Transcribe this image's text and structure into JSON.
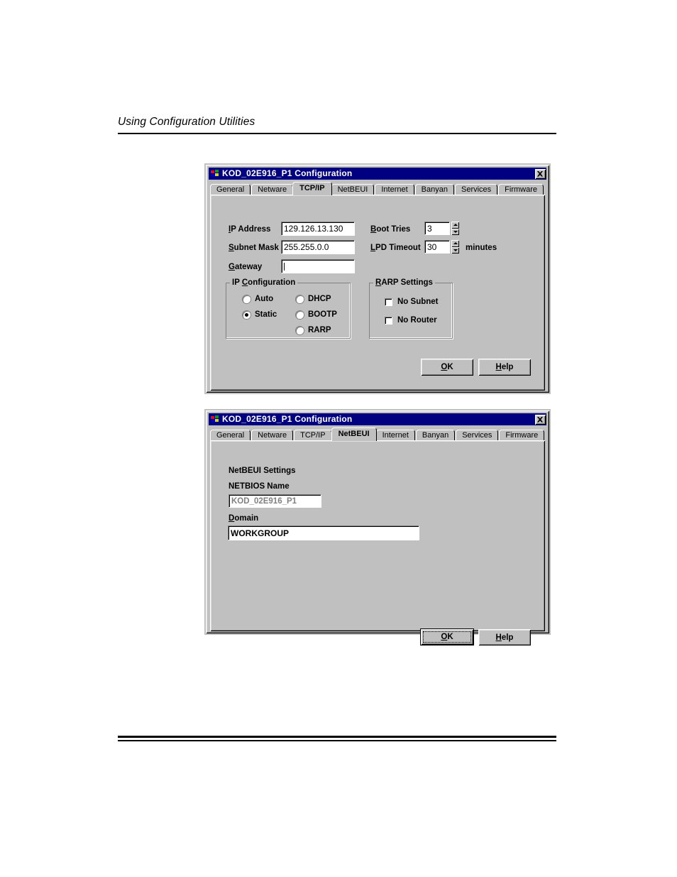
{
  "document": {
    "running_head": "Using Configuration Utilities"
  },
  "dialogs": [
    {
      "title": "KOD_02E916_P1 Configuration",
      "close_label": "Close",
      "tabs": [
        {
          "label": "General",
          "selected": false
        },
        {
          "label": "Netware",
          "selected": false
        },
        {
          "label": "TCP/IP",
          "selected": true
        },
        {
          "label": "NetBEUI",
          "selected": false
        },
        {
          "label": "Internet",
          "selected": false
        },
        {
          "label": "Banyan",
          "selected": false
        },
        {
          "label": "Services",
          "selected": false
        },
        {
          "label": "Firmware",
          "selected": false
        }
      ],
      "fields": {
        "ip_address_label": "IP Address",
        "ip_address_accel": "I",
        "ip_address_value": "129.126.13.130",
        "subnet_mask_label": "Subnet Mask",
        "subnet_mask_accel": "S",
        "subnet_mask_value": "255.255.0.0",
        "gateway_label": "Gateway",
        "gateway_accel": "G",
        "gateway_value": "",
        "boot_tries_label": "Boot Tries",
        "boot_tries_accel": "B",
        "boot_tries_value": "3",
        "lpd_timeout_label": "LPD Timeout",
        "lpd_timeout_accel": "L",
        "lpd_timeout_value": "30",
        "lpd_timeout_units": "minutes"
      },
      "ip_configuration": {
        "title": "IP Configuration",
        "accel": "C",
        "options": [
          {
            "label": "Auto",
            "selected": false
          },
          {
            "label": "Static",
            "selected": true
          },
          {
            "label": "DHCP",
            "selected": false
          },
          {
            "label": "BOOTP",
            "selected": false
          },
          {
            "label": "RARP",
            "selected": false
          }
        ]
      },
      "rarp_settings": {
        "title": "RARP Settings",
        "accel": "R",
        "options": [
          {
            "label": "No Subnet",
            "checked": false
          },
          {
            "label": "No Router",
            "checked": false
          }
        ]
      },
      "buttons": [
        {
          "label": "OK",
          "accel": "O",
          "default": false,
          "focused": false
        },
        {
          "label": "Help",
          "accel": "H",
          "default": false,
          "focused": false
        }
      ]
    },
    {
      "title": "KOD_02E916_P1 Configuration",
      "close_label": "Close",
      "tabs": [
        {
          "label": "General",
          "selected": false
        },
        {
          "label": "Netware",
          "selected": false
        },
        {
          "label": "TCP/IP",
          "selected": false
        },
        {
          "label": "NetBEUI",
          "selected": true
        },
        {
          "label": "Internet",
          "selected": false
        },
        {
          "label": "Banyan",
          "selected": false
        },
        {
          "label": "Services",
          "selected": false
        },
        {
          "label": "Firmware",
          "selected": false
        }
      ],
      "netbeui": {
        "section_title": "NetBEUI Settings",
        "netbios_label": "NETBIOS Name",
        "netbios_value": "KOD_02E916_P1",
        "netbios_disabled": true,
        "domain_label": "Domain",
        "domain_accel": "D",
        "domain_value": "WORKGROUP"
      },
      "buttons": [
        {
          "label": "OK",
          "accel": "O",
          "default": true,
          "focused": true
        },
        {
          "label": "Help",
          "accel": "H",
          "default": false,
          "focused": false
        }
      ]
    }
  ],
  "colors": {
    "face": "#c0c0c0",
    "titlebar": "#000080",
    "titlebar_text": "#ffffff",
    "field_bg": "#ffffff",
    "disabled_text": "#808080"
  }
}
